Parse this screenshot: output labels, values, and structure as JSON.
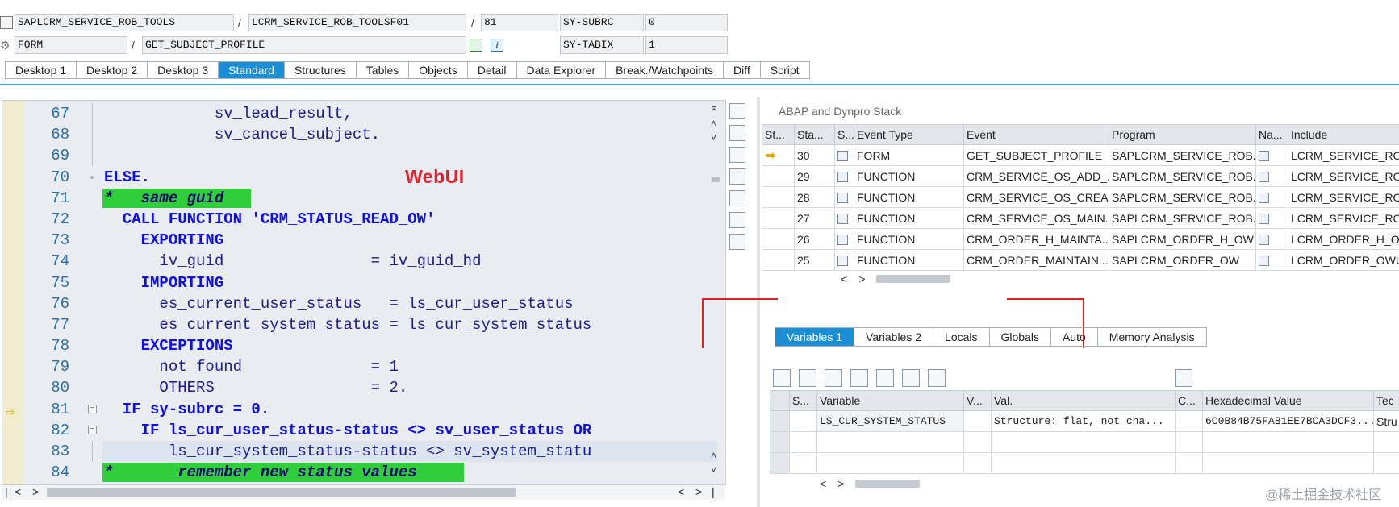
{
  "header": {
    "program": "SAPLCRM_SERVICE_ROB_TOOLS",
    "include": "LCRM_SERVICE_ROB_TOOLSF01",
    "line": "81",
    "subrc_label": "SY-SUBRC",
    "subrc_value": "0",
    "event_type": "FORM",
    "event_name": "GET_SUBJECT_PROFILE",
    "tabix_label": "SY-TABIX",
    "tabix_value": "1",
    "sep": "/"
  },
  "tabs": [
    "Desktop 1",
    "Desktop 2",
    "Desktop 3",
    "Standard",
    "Structures",
    "Tables",
    "Objects",
    "Detail",
    "Data Explorer",
    "Break./Watchpoints",
    "Diff",
    "Script"
  ],
  "active_tab": "Standard",
  "editor": {
    "overlay_label": "WebUI",
    "lines": [
      {
        "n": "67",
        "t": "            sv_lead_result,"
      },
      {
        "n": "68",
        "t": "            sv_cancel_subject."
      },
      {
        "n": "69",
        "t": ""
      },
      {
        "n": "70",
        "t": "ELSE."
      },
      {
        "n": "71",
        "t": "*   same guid"
      },
      {
        "n": "72",
        "t": "  CALL FUNCTION 'CRM_STATUS_READ_OW'"
      },
      {
        "n": "73",
        "t": "    EXPORTING"
      },
      {
        "n": "74",
        "t": "      iv_guid                = iv_guid_hd"
      },
      {
        "n": "75",
        "t": "    IMPORTING"
      },
      {
        "n": "76",
        "t": "      es_current_user_status   = ls_cur_user_status"
      },
      {
        "n": "77",
        "t": "      es_current_system_status = ls_cur_system_status"
      },
      {
        "n": "78",
        "t": "    EXCEPTIONS"
      },
      {
        "n": "79",
        "t": "      not_found              = 1"
      },
      {
        "n": "80",
        "t": "      OTHERS                 = 2."
      },
      {
        "n": "81",
        "t": "  IF sy-subrc = 0."
      },
      {
        "n": "82",
        "t": "    IF ls_cur_user_status-status <> sv_user_status OR"
      },
      {
        "n": "83",
        "t": "       ls_cur_system_status-status <> sv_system_statu"
      },
      {
        "n": "84",
        "t": "*       remember new status values"
      }
    ]
  },
  "stack": {
    "title": "ABAP and Dynpro Stack",
    "columns": [
      "St...",
      "Sta...",
      "S...",
      "Event Type",
      "Event",
      "Program",
      "Na...",
      "Include"
    ],
    "rows": [
      {
        "level": "30",
        "type": "FORM",
        "event": "GET_SUBJECT_PROFILE",
        "program": "SAPLCRM_SERVICE_ROB...",
        "include": "LCRM_SERVICE_RO"
      },
      {
        "level": "29",
        "type": "FUNCTION",
        "event": "CRM_SERVICE_OS_ADD_...",
        "program": "SAPLCRM_SERVICE_ROB...",
        "include": "LCRM_SERVICE_RO"
      },
      {
        "level": "28",
        "type": "FUNCTION",
        "event": "CRM_SERVICE_OS_CREA...",
        "program": "SAPLCRM_SERVICE_ROB...",
        "include": "LCRM_SERVICE_RO"
      },
      {
        "level": "27",
        "type": "FUNCTION",
        "event": "CRM_SERVICE_OS_MAIN...",
        "program": "SAPLCRM_SERVICE_ROB...",
        "include": "LCRM_SERVICE_RO"
      },
      {
        "level": "26",
        "type": "FUNCTION",
        "event": "CRM_ORDER_H_MAINTA...",
        "program": "SAPLCRM_ORDER_H_OW",
        "include": "LCRM_ORDER_H_O"
      },
      {
        "level": "25",
        "type": "FUNCTION",
        "event": "CRM_ORDER_MAINTAIN...",
        "program": "SAPLCRM_ORDER_OW",
        "include": "LCRM_ORDER_OWU"
      }
    ]
  },
  "var_tabs": [
    "Variables 1",
    "Variables 2",
    "Locals",
    "Globals",
    "Auto",
    "Memory Analysis"
  ],
  "var_active": "Variables 1",
  "variables": {
    "columns": [
      "S...",
      "Variable",
      "V...",
      "Val.",
      "C...",
      "Hexadecimal Value",
      "Tec"
    ],
    "rows": [
      {
        "name": "LS_CUR_SYSTEM_STATUS",
        "val": "Structure: flat, not cha...",
        "hex": "6C0B84B75FAB1EE7BCA3DCF3...",
        "tec": "Stru"
      }
    ]
  },
  "scroll": {
    "left": "<",
    "right": ">",
    "grip": "|||"
  },
  "watermark": "@稀土掘金技术社区"
}
